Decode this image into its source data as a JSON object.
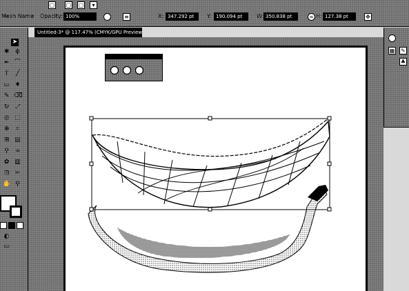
{
  "control_bar": {
    "workspace_label": "Mesh Name",
    "opacity_label": "Opacity:",
    "opacity_value": "100%",
    "x_label": "X:",
    "x_value": "347.292 pt",
    "y_label": "Y:",
    "y_value": "190.094 pt",
    "w_label": "W:",
    "w_value": "350.838 pt",
    "h_label": "H:",
    "h_value": "127.38 pt"
  },
  "document": {
    "tab_title": "Untitled-3* @ 117.47% (CMYK/GPU Preview)"
  },
  "colors": {
    "panel": "#bdbdbd",
    "artboard": "#ffffff",
    "outline": "#000000"
  }
}
